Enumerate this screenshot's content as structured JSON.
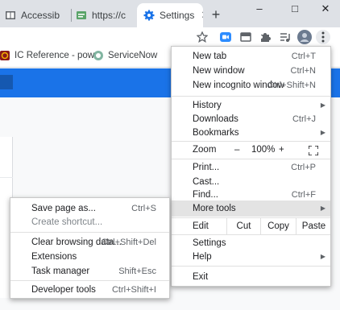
{
  "tabs": [
    {
      "title": "Accessib",
      "icon": "book-icon",
      "active": false
    },
    {
      "title": "https://c",
      "icon": "page-icon",
      "active": false
    },
    {
      "title": "Settings",
      "icon": "gear-icon",
      "active": true
    }
  ],
  "new_tab_symbol": "+",
  "window_controls": {
    "minimize": "–",
    "maximize": "□",
    "close": "✕"
  },
  "toolbar": {
    "icons": [
      "bookmark-star-icon",
      "zoom-video-icon",
      "extension-grid-icon",
      "puzzle-icon",
      "playlist-icon",
      "profile-avatar-icon",
      "more-menu-icon"
    ]
  },
  "bookmarks": [
    {
      "label": "IC Reference - pow...",
      "icon": "ic-reference-icon"
    },
    {
      "label": "ServiceNow",
      "icon": "servicenow-icon"
    }
  ],
  "main_menu": {
    "new_tab": {
      "label": "New tab",
      "shortcut": "Ctrl+T"
    },
    "new_window": {
      "label": "New window",
      "shortcut": "Ctrl+N"
    },
    "new_incognito": {
      "label": "New incognito window",
      "shortcut": "Ctrl+Shift+N"
    },
    "history": {
      "label": "History"
    },
    "downloads": {
      "label": "Downloads",
      "shortcut": "Ctrl+J"
    },
    "bookmarks": {
      "label": "Bookmarks"
    },
    "zoom": {
      "label": "Zoom",
      "minus": "–",
      "value": "100%",
      "plus": "+",
      "fullscreen_icon": "fullscreen-icon"
    },
    "print": {
      "label": "Print...",
      "shortcut": "Ctrl+P"
    },
    "cast": {
      "label": "Cast..."
    },
    "find": {
      "label": "Find...",
      "shortcut": "Ctrl+F"
    },
    "more_tools": {
      "label": "More tools"
    },
    "edit": {
      "label": "Edit",
      "cut": "Cut",
      "copy": "Copy",
      "paste": "Paste"
    },
    "settings": {
      "label": "Settings"
    },
    "help": {
      "label": "Help"
    },
    "exit": {
      "label": "Exit"
    }
  },
  "more_tools_menu": {
    "save_page": {
      "label": "Save page as...",
      "shortcut": "Ctrl+S"
    },
    "create_shortcut": {
      "label": "Create shortcut..."
    },
    "clear_browsing": {
      "label": "Clear browsing data...",
      "shortcut": "Ctrl+Shift+Del"
    },
    "extensions": {
      "label": "Extensions"
    },
    "task_manager": {
      "label": "Task manager",
      "shortcut": "Shift+Esc"
    },
    "developer_tools": {
      "label": "Developer tools",
      "shortcut": "Ctrl+Shift+I"
    }
  },
  "colors": {
    "accent": "#1a73e8",
    "menu_highlight": "#e3e3e3"
  }
}
